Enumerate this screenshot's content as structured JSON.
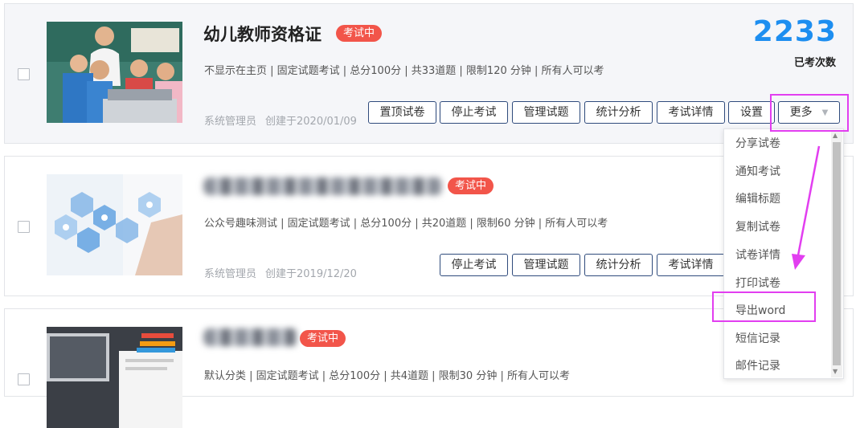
{
  "cards": [
    {
      "title": "幼儿教师资格证",
      "badge": "考试中",
      "meta": "不显示在主页 | 固定试题考试 | 总分100分 | 共33道题 | 限制120 分钟 | 所有人可以考",
      "creator": "系统管理员",
      "created": "创建于2020/01/09",
      "count": "2233",
      "count_label": "已考次数",
      "buttons": [
        "置顶试卷",
        "停止考试",
        "管理试题",
        "统计分析",
        "考试详情",
        "设置",
        "更多"
      ]
    },
    {
      "badge": "考试中",
      "meta": "公众号趣味测试 | 固定试题考试 | 总分100分 | 共20道题 | 限制60 分钟 | 所有人可以考",
      "creator": "系统管理员",
      "created": "创建于2019/12/20",
      "buttons": [
        "停止考试",
        "管理试题",
        "统计分析",
        "考试详情"
      ]
    },
    {
      "badge": "考试中",
      "meta": "默认分类 | 固定试题考试 | 总分100分 | 共4道题 | 限制30 分钟 | 所有人可以考"
    }
  ],
  "dropdown": {
    "items": [
      "分享试卷",
      "通知考试",
      "编辑标题",
      "复制试卷",
      "试卷详情",
      "打印试卷",
      "导出word",
      "短信记录",
      "邮件记录"
    ]
  },
  "colors": {
    "accent": "#1d8ef0",
    "badge": "#f2554a",
    "highlight": "#e23ef0",
    "button_border": "#2f4b7c"
  }
}
